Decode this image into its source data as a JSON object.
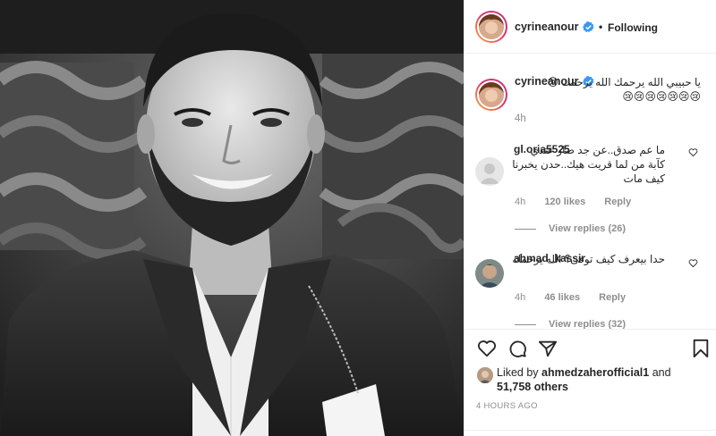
{
  "post": {
    "username": "cyrineanour",
    "follow_label": "Following",
    "dot": "•"
  },
  "caption": {
    "username": "cyrineanour",
    "text": "يا حبيبي الله يرحمك الله يرحمك 😢😢😢😢😢😢😢😢",
    "time": "4h"
  },
  "comments": [
    {
      "username": "gl.oria5525",
      "text": "ما عم صدق..عن جد صار عندي كآبة من لما قريت هيك..حدن يخبرنا كيف مات",
      "time": "4h",
      "likes": "120 likes",
      "reply": "Reply",
      "view_replies": "View replies (26)"
    },
    {
      "username": "ahmad_kassir",
      "text": "حدا بيعرف كيف توفى؟ الله يرحمك",
      "time": "4h",
      "likes": "46 likes",
      "reply": "Reply",
      "view_replies": "View replies (32)"
    }
  ],
  "likes_block": {
    "prefix": "Liked by ",
    "liker": "ahmedzaherofficial1",
    "middle": " and",
    "count": "51,758",
    "suffix": " others"
  },
  "timestamp": "4 HOURS AGO",
  "icons": [
    "verified-badge-icon",
    "heart-icon",
    "comment-icon",
    "share-icon",
    "bookmark-icon"
  ],
  "colors": {
    "verified": "#3897f0",
    "muted": "#8e8e8e",
    "text": "#262626",
    "border": "#efefef"
  }
}
